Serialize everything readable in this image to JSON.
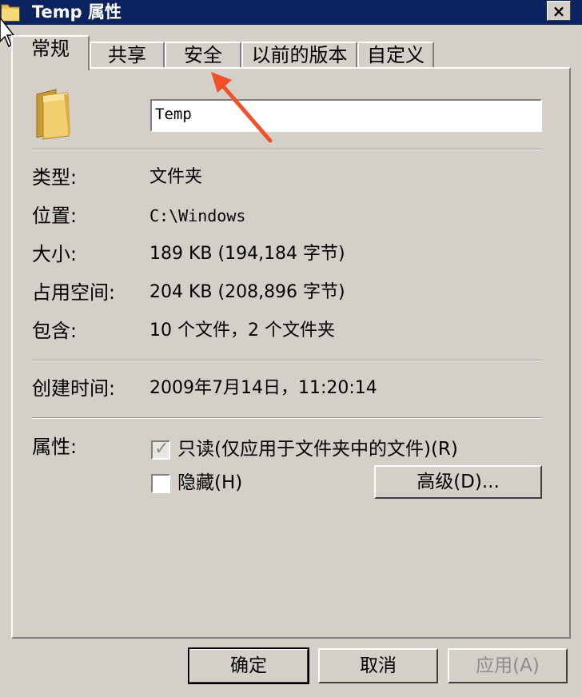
{
  "window": {
    "title": "Temp 属性",
    "close_label": "×"
  },
  "tabs": [
    {
      "label": "常规",
      "active": true
    },
    {
      "label": "共享",
      "active": false
    },
    {
      "label": "安全",
      "active": false
    },
    {
      "label": "以前的版本",
      "active": false
    },
    {
      "label": "自定义",
      "active": false
    }
  ],
  "general": {
    "name_value": "Temp",
    "rows": [
      {
        "label": "类型:",
        "value": "文件夹"
      },
      {
        "label": "位置:",
        "value": "C:\\Windows"
      },
      {
        "label": "大小:",
        "value": "189 KB (194,184 字节)"
      },
      {
        "label": "占用空间:",
        "value": "204 KB (208,896 字节)"
      },
      {
        "label": "包含:",
        "value": "10 个文件，2 个文件夹"
      }
    ],
    "created_label": "创建时间:",
    "created_value": "2009年7月14日，11:20:14",
    "attributes_label": "属性:",
    "readonly_label": "只读(仅应用于文件夹中的文件)(R)",
    "readonly_checked": true,
    "hidden_label": "隐藏(H)",
    "hidden_checked": false,
    "advanced_button": "高级(D)..."
  },
  "footer": {
    "ok": "确定",
    "cancel": "取消",
    "apply": "应用(A)"
  },
  "colors": {
    "titlebar": "#0b2460",
    "face": "#d4d0c8",
    "annotation_arrow": "#f0502a"
  },
  "icons": {
    "title": "folder-icon",
    "main": "folder-icon",
    "annotation": "arrow-icon",
    "cursor": "mouse-cursor-icon"
  }
}
